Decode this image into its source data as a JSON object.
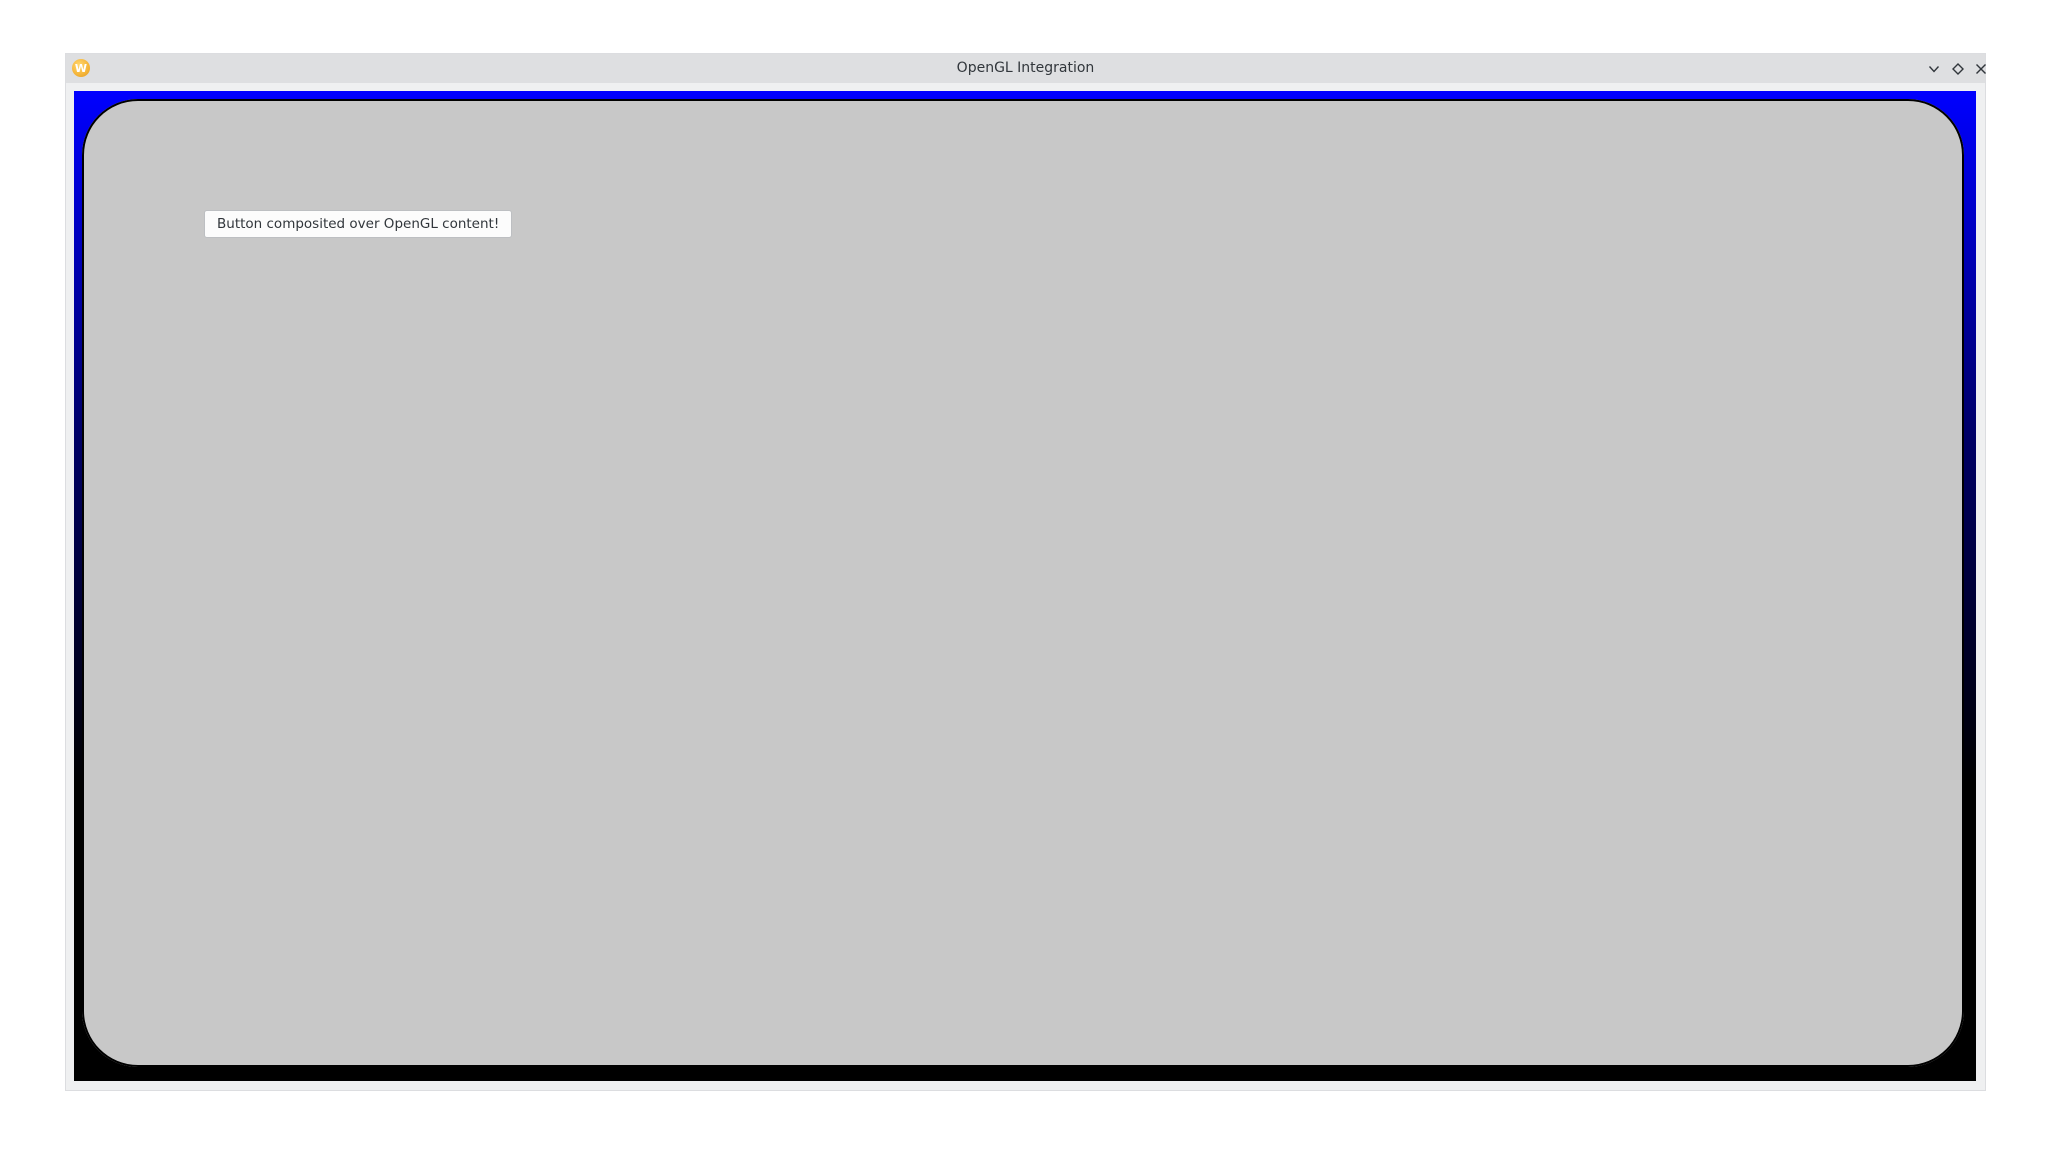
{
  "window": {
    "title": "OpenGL Integration",
    "app_icon_glyph": "W",
    "controls": {
      "minimize_icon": "chevron-down-icon",
      "maximize_icon": "diamond-icon",
      "close_icon": "close-icon"
    }
  },
  "gl_view": {
    "gradient_top_color": "#0000ff",
    "gradient_bottom_color": "#000000",
    "panel_color": "#c8c8c8",
    "button_label": "Button composited over OpenGL content!"
  }
}
